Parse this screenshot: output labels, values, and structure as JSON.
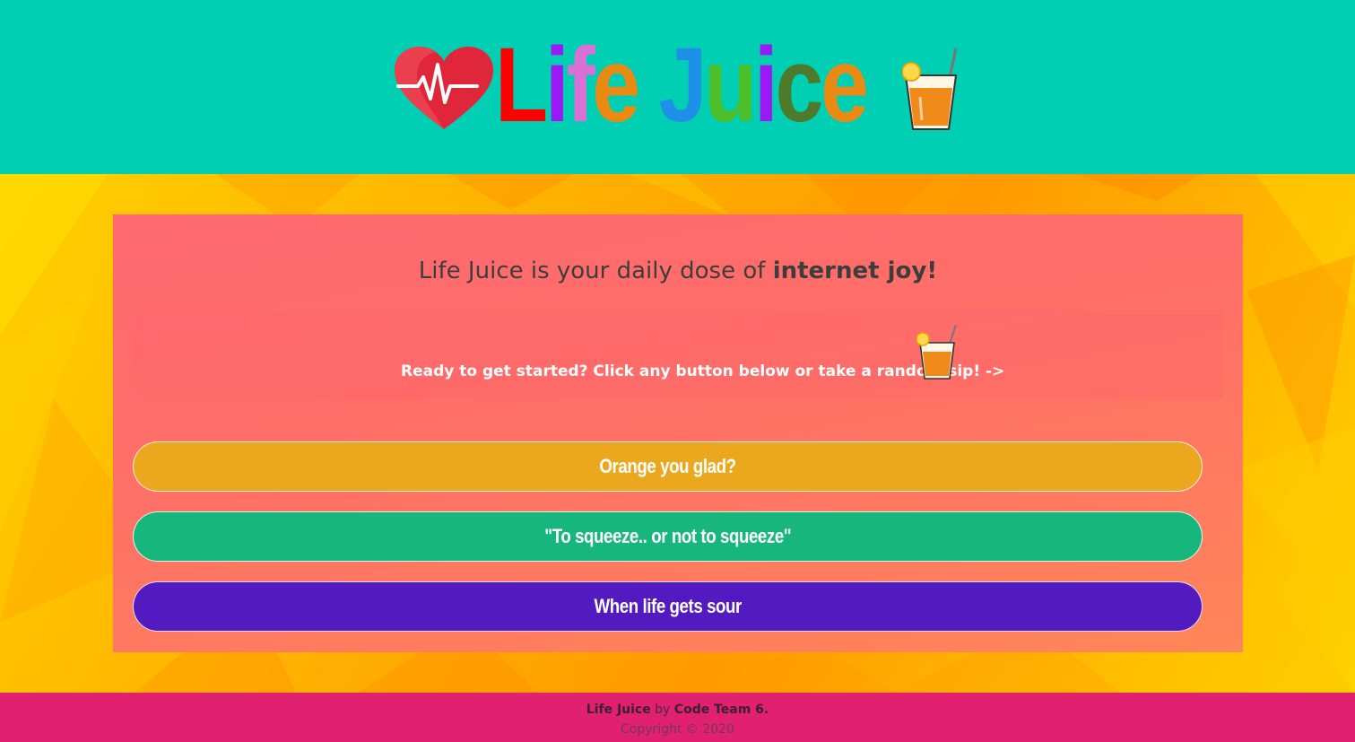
{
  "header": {
    "logo": {
      "text": "Life Juice",
      "letters": [
        {
          "char": "L",
          "color": "#ff0000"
        },
        {
          "char": "i",
          "color": "#9b19f5"
        },
        {
          "char": "f",
          "color": "#da70d6"
        },
        {
          "char": "e",
          "color": "#ea8a12"
        },
        {
          "char": " ",
          "color": "#000000"
        },
        {
          "char": "J",
          "color": "#1e90e8"
        },
        {
          "char": "u",
          "color": "#4cbf2a"
        },
        {
          "char": "i",
          "color": "#9b19f5"
        },
        {
          "char": "c",
          "color": "#4e7a2c"
        },
        {
          "char": "e",
          "color": "#ea8a12"
        }
      ],
      "heart_icon": "heartbeat-heart-icon",
      "glass_icon": "juice-glass-icon"
    }
  },
  "card": {
    "tagline_plain": "Life Juice is your daily dose of ",
    "tagline_bold": "internet joy!",
    "prompt": "Ready to get started? Click any button below or take a random sip! ->",
    "random_sip_icon": "juice-glass-icon"
  },
  "buttons": [
    {
      "label": "Orange you glad?",
      "color": "#eba81f"
    },
    {
      "label": "\"To squeeze.. or not to squeeze\"",
      "color": "#17b67d"
    },
    {
      "label": "When life gets sour",
      "color": "#521ac0"
    }
  ],
  "footer": {
    "brand": "Life Juice",
    "by": " by ",
    "team": "Code Team 6.",
    "copyright": "Copyright © 2020"
  },
  "colors": {
    "header_bg": "#00cfb3",
    "footer_bg": "#e1206f",
    "card_bg": "#ff6f6a"
  }
}
